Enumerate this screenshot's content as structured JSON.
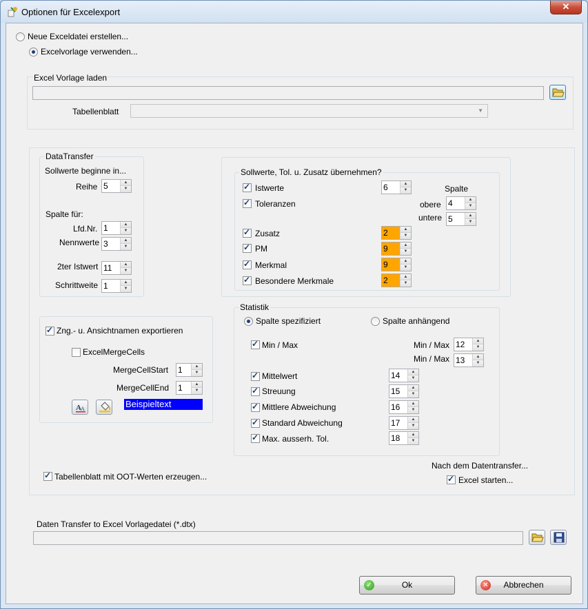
{
  "window": {
    "title": "Optionen für Excelexport",
    "close": "✕"
  },
  "mode": {
    "new_file": {
      "label": "Neue Exceldatei erstellen...",
      "checked": false
    },
    "use_template": {
      "label": "Excelvorlage verwenden...",
      "checked": true
    }
  },
  "template": {
    "group_label": "Excel Vorlage laden",
    "path_value": "",
    "sheet_label": "Tabellenblatt",
    "sheet_value": ""
  },
  "datatransfer": {
    "group_label": "DataTransfer",
    "sollwerte_label": "Sollwerte beginne in...",
    "reihe_label": "Reihe",
    "reihe_value": "5",
    "spalte_fuer_label": "Spalte für:",
    "lfdnr_label": "Lfd.Nr.",
    "lfdnr_value": "1",
    "nennwerte_label": "Nennwerte",
    "nennwerte_value": "3",
    "istwert2_label": "2ter Istwert",
    "istwert2_value": "11",
    "schrittweite_label": "Schrittweite",
    "schrittweite_value": "1"
  },
  "uebernehmen": {
    "group_label": "Sollwerte, Tol. u. Zusatz übernehmen?",
    "istwerte": {
      "label": "Istwerte",
      "checked": true,
      "value": "6"
    },
    "toleranzen": {
      "label": "Toleranzen",
      "checked": true
    },
    "spalte_label": "Spalte",
    "obere_label": "obere",
    "obere_value": "4",
    "untere_label": "untere",
    "untere_value": "5",
    "zusatz": {
      "label": "Zusatz",
      "checked": true,
      "value": "2"
    },
    "pm": {
      "label": "PM",
      "checked": true,
      "value": "9"
    },
    "merkmal": {
      "label": "Merkmal",
      "checked": true,
      "value": "9"
    },
    "besondere": {
      "label": "Besondere Merkmale",
      "checked": true,
      "value": "2"
    }
  },
  "names": {
    "export": {
      "label": "Zng.- u. Ansichtnamen exportieren",
      "checked": true
    },
    "mergecells": {
      "label": "ExcelMergeCells",
      "checked": false
    },
    "mergestart_label": "MergeCellStart",
    "mergestart_value": "1",
    "mergeend_label": "MergeCellEnd",
    "mergeend_value": "1",
    "sample_text": "Beispieltext"
  },
  "statistik": {
    "group_label": "Statistik",
    "spalte_spezifiziert": {
      "label": "Spalte spezifiziert",
      "checked": true
    },
    "spalte_anhaengend": {
      "label": "Spalte anhängend",
      "checked": false
    },
    "minmax": {
      "label": "Min / Max",
      "checked": true
    },
    "minmax1_label": "Min / Max",
    "minmax1_value": "12",
    "minmax2_label": "Min / Max",
    "minmax2_value": "13",
    "mittelwert": {
      "label": "Mittelwert",
      "checked": true,
      "value": "14"
    },
    "streuung": {
      "label": "Streuung",
      "checked": true,
      "value": "15"
    },
    "mittlere": {
      "label": "Mittlere Abweichung",
      "checked": true,
      "value": "16"
    },
    "standard": {
      "label": "Standard Abweichung",
      "checked": true,
      "value": "17"
    },
    "maxausserh": {
      "label": "Max. ausserh. Tol.",
      "checked": true,
      "value": "18"
    }
  },
  "oot": {
    "label": "Tabellenblatt mit OOT-Werten erzeugen...",
    "checked": true
  },
  "after_transfer": {
    "heading": "Nach dem Datentransfer...",
    "excel_starten": {
      "label": "Excel starten...",
      "checked": true
    }
  },
  "dtx": {
    "label": "Daten Transfer to Excel Vorlagedatei (*.dtx)",
    "path_value": ""
  },
  "buttons": {
    "ok": "Ok",
    "cancel": "Abbrechen"
  },
  "colors": {
    "highlight_orange": "#ffa500",
    "sample_bg": "#0000ff",
    "sample_fg": "#ffffff"
  }
}
